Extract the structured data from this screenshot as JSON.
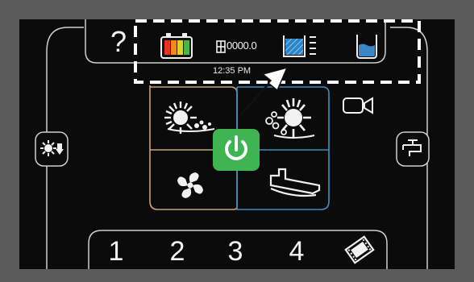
{
  "top_bar": {
    "help_label": "?",
    "hour_meter": "0000.0",
    "time": "12:35 PM"
  },
  "icons": {
    "help": "question-mark-icon",
    "battery": "battery-icon",
    "hour_meter": "hour-meter-icon",
    "solution_tank": "solution-tank-level-icon",
    "recovery_tank": "recovery-tank-level-icon",
    "brush_scrub": "scrub-brush-icon",
    "brush_heavy": "heavy-scrub-brush-icon",
    "vacuum": "vacuum-fan-icon",
    "squeegee": "squeegee-icon",
    "power": "power-icon",
    "camera": "camera-icon",
    "brush_down": "brush-down-icon",
    "faucet": "water-faucet-icon",
    "video": "video-film-icon"
  },
  "presets": [
    "1",
    "2",
    "3",
    "4"
  ],
  "colors": {
    "screen_bg": "#0b0b0b",
    "power_green": "#3fb551",
    "left_pad_outline": "#c7a478",
    "right_pad_outline": "#3b8fc2",
    "battery_red": "#e53222",
    "battery_orange": "#f08a1c",
    "battery_yellow": "#dcd22a",
    "battery_green": "#49b548",
    "tank_blue": "#3a87c8",
    "annotation": "#ffffff"
  },
  "annotation": {
    "type": "dashed-box-with-arrow"
  }
}
